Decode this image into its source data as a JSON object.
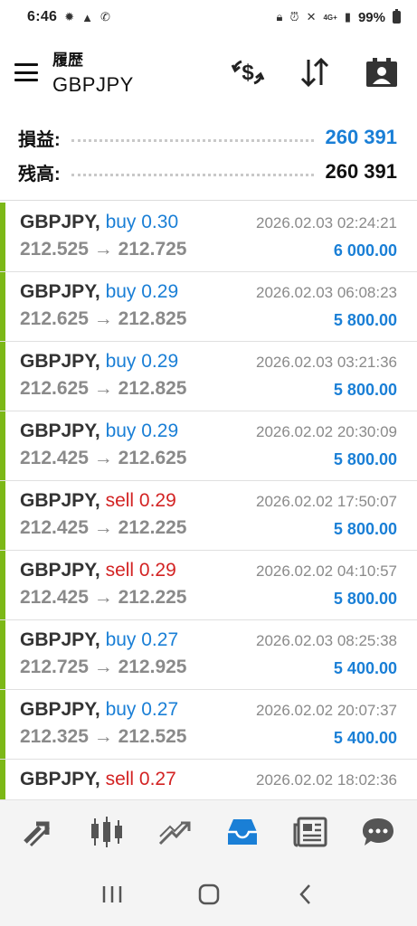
{
  "status": {
    "time": "6:46",
    "battery": "99%",
    "network": "4G+"
  },
  "header": {
    "subtitle": "履歴",
    "title": "GBPJPY"
  },
  "summary": {
    "profit_label": "損益:",
    "profit_value": "260 391",
    "balance_label": "残高:",
    "balance_value": "260 391"
  },
  "trades": [
    {
      "symbol": "GBPJPY,",
      "type": "buy",
      "volume": "buy 0.30",
      "prices": "212.525 → 212.725",
      "time": "2026.02.03 02:24:21",
      "profit": "6 000.00"
    },
    {
      "symbol": "GBPJPY,",
      "type": "buy",
      "volume": "buy 0.29",
      "prices": "212.625 → 212.825",
      "time": "2026.02.03 06:08:23",
      "profit": "5 800.00"
    },
    {
      "symbol": "GBPJPY,",
      "type": "buy",
      "volume": "buy 0.29",
      "prices": "212.625 → 212.825",
      "time": "2026.02.03 03:21:36",
      "profit": "5 800.00"
    },
    {
      "symbol": "GBPJPY,",
      "type": "buy",
      "volume": "buy 0.29",
      "prices": "212.425 → 212.625",
      "time": "2026.02.02 20:30:09",
      "profit": "5 800.00"
    },
    {
      "symbol": "GBPJPY,",
      "type": "sell",
      "volume": "sell 0.29",
      "prices": "212.425 → 212.225",
      "time": "2026.02.02 17:50:07",
      "profit": "5 800.00"
    },
    {
      "symbol": "GBPJPY,",
      "type": "sell",
      "volume": "sell 0.29",
      "prices": "212.425 → 212.225",
      "time": "2026.02.02 04:10:57",
      "profit": "5 800.00"
    },
    {
      "symbol": "GBPJPY,",
      "type": "buy",
      "volume": "buy 0.27",
      "prices": "212.725 → 212.925",
      "time": "2026.02.03 08:25:38",
      "profit": "5 400.00"
    },
    {
      "symbol": "GBPJPY,",
      "type": "buy",
      "volume": "buy 0.27",
      "prices": "212.325 → 212.525",
      "time": "2026.02.02 20:07:37",
      "profit": "5 400.00"
    },
    {
      "symbol": "GBPJPY,",
      "type": "sell",
      "volume": "sell 0.27",
      "prices": "",
      "time": "2026.02.02 18:02:36",
      "profit": ""
    }
  ],
  "nav": {
    "items": [
      "quotes-icon",
      "chart-icon",
      "trade-icon",
      "history-icon",
      "news-icon",
      "messages-icon"
    ],
    "active": "history-icon"
  },
  "colors": {
    "accent": "#1a7fd6",
    "sell": "#d32323",
    "profit_bar": "#7cb817",
    "muted": "#8a8a8a"
  }
}
